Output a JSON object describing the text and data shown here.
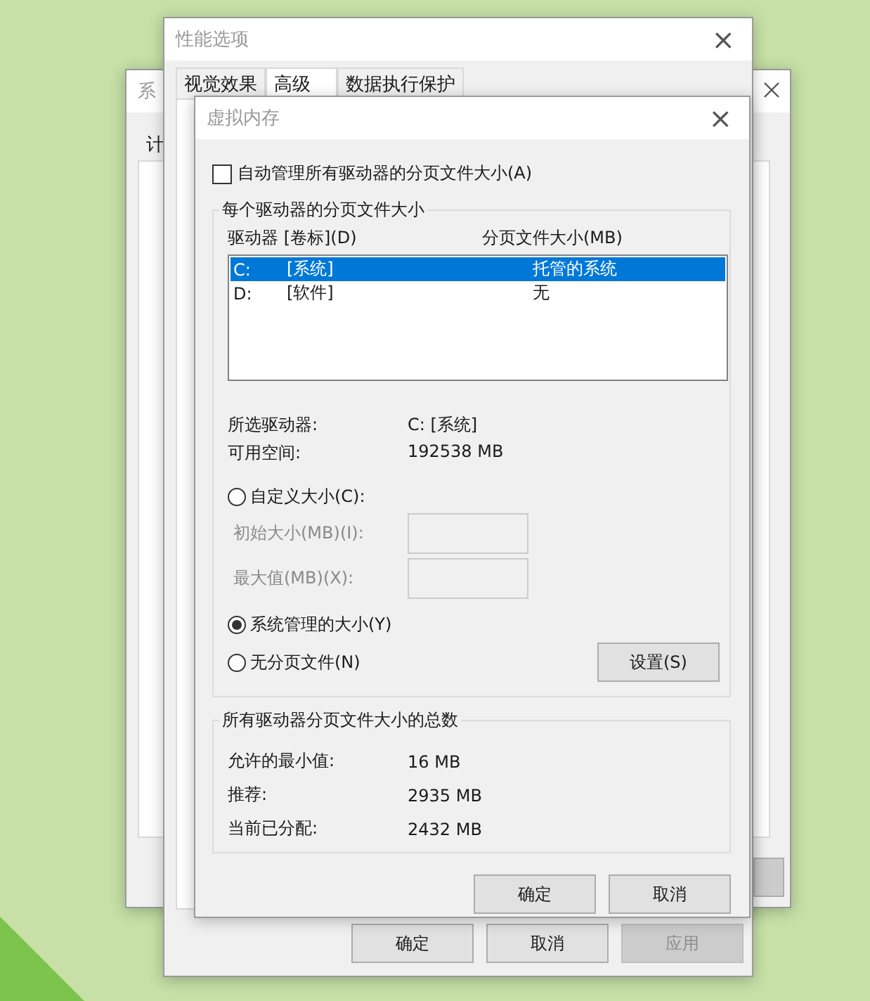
{
  "background_window": {
    "title": "系",
    "tab": "计"
  },
  "performance_window": {
    "title": "性能选项",
    "close": "×",
    "tabs": [
      {
        "label": "视觉效果",
        "selected": false
      },
      {
        "label": "高级",
        "selected": true
      },
      {
        "label": "数据执行保护",
        "selected": false
      }
    ],
    "buttons": [
      {
        "label": "确定",
        "disabled": false
      },
      {
        "label": "取消",
        "disabled": false
      },
      {
        "label": "应用",
        "disabled": true
      }
    ]
  },
  "virtual_memory": {
    "title": "虚拟内存",
    "close": "×",
    "auto_manage": {
      "label": "自动管理所有驱动器的分页文件大小(A)",
      "checked": false
    },
    "per_drive": {
      "legend": "每个驱动器的分页文件大小",
      "columns": [
        "驱动器 [卷标](D)",
        "分页文件大小(MB)"
      ],
      "rows": [
        {
          "drive": "C:",
          "label": "[系统]",
          "size": "托管的系统",
          "selected": true
        },
        {
          "drive": "D:",
          "label": "[软件]",
          "size": "无",
          "selected": false
        }
      ],
      "selected_drive": {
        "label": "所选驱动器:",
        "value": "C:  [系统]"
      },
      "free_space": {
        "label": "可用空间:",
        "value": "192538 MB"
      },
      "options": [
        {
          "kind": "custom",
          "label": "自定义大小(C):",
          "selected": false
        },
        {
          "kind": "system",
          "label": "系统管理的大小(Y)",
          "selected": true
        },
        {
          "kind": "none",
          "label": "无分页文件(N)",
          "selected": false
        }
      ],
      "fields": [
        {
          "label": "初始大小(MB)(I):",
          "disabled": true
        },
        {
          "label": "最大值(MB)(X):",
          "disabled": true
        }
      ],
      "set_button": "设置(S)"
    },
    "totals": {
      "legend": "所有驱动器分页文件大小的总数",
      "rows": [
        {
          "label": "允许的最小值:",
          "value": "16 MB"
        },
        {
          "label": "推荐:",
          "value": "2935 MB"
        },
        {
          "label": "当前已分配:",
          "value": "2432 MB"
        }
      ]
    },
    "buttons": [
      {
        "label": "确定",
        "disabled": false
      },
      {
        "label": "取消",
        "disabled": false
      }
    ]
  }
}
